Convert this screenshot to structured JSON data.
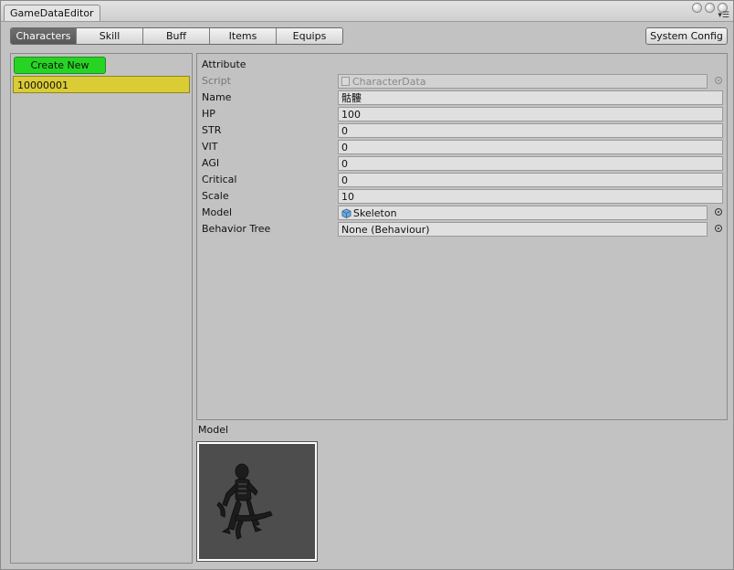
{
  "window": {
    "title": "GameDataEditor"
  },
  "toolbar": {
    "tabs": [
      {
        "label": "Characters",
        "active": true
      },
      {
        "label": "Skill",
        "active": false
      },
      {
        "label": "Buff",
        "active": false
      },
      {
        "label": "Items",
        "active": false
      },
      {
        "label": "Equips",
        "active": false
      }
    ],
    "system_config": "System Config"
  },
  "left": {
    "create_new": "Create New",
    "items": [
      {
        "label": "10000001",
        "selected": true
      }
    ]
  },
  "attributes": {
    "title": "Attribute",
    "script": {
      "label": "Script",
      "value": "CharacterData"
    },
    "name": {
      "label": "Name",
      "value": "骷髏"
    },
    "hp": {
      "label": "HP",
      "value": "100"
    },
    "str": {
      "label": "STR",
      "value": "0"
    },
    "vit": {
      "label": "VIT",
      "value": "0"
    },
    "agi": {
      "label": "AGI",
      "value": "0"
    },
    "critical": {
      "label": "Critical",
      "value": "0"
    },
    "scale": {
      "label": "Scale",
      "value": "10"
    },
    "model": {
      "label": "Model",
      "value": "Skeleton"
    },
    "behavior_tree": {
      "label": "Behavior Tree",
      "value": "None (Behaviour)"
    }
  },
  "preview": {
    "label": "Model"
  },
  "colors": {
    "create_button": "#27d424",
    "selected_item": "#d9cc35",
    "active_tab": "#606060",
    "panel_bg": "#c2c2c2"
  }
}
